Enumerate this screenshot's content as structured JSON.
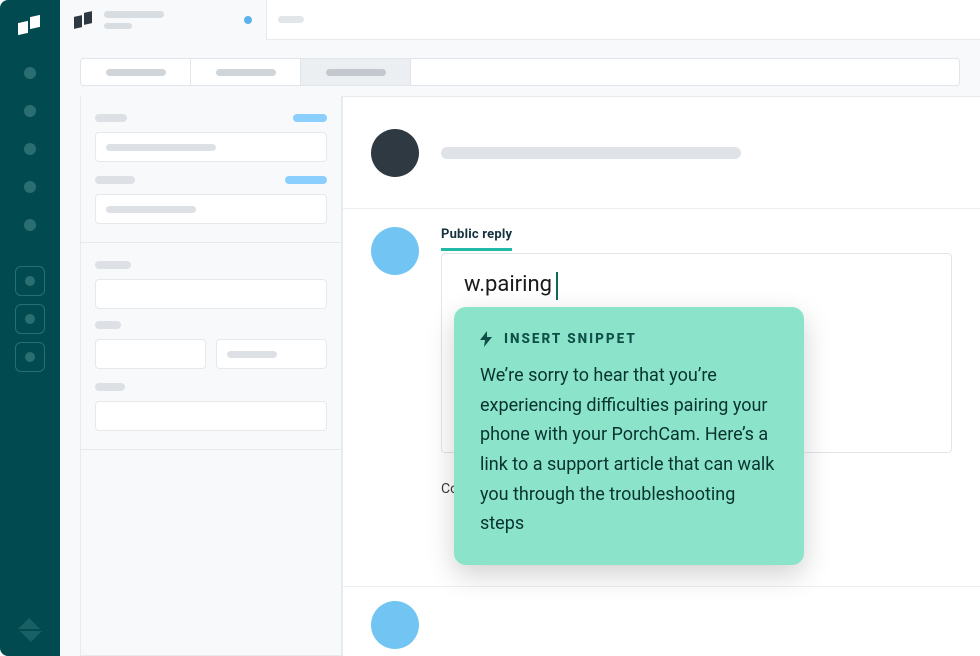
{
  "reply": {
    "tab_label": "Public reply",
    "typed_text": "w.pairing",
    "footer_visible_text": "Co"
  },
  "snippet": {
    "title": "INSERT SNIPPET",
    "body": "We’re sorry to hear that you’re experiencing difficulties pairing your phone with your PorchCam. Here’s a link to a support article that can walk you through the troubleshooting steps"
  },
  "colors": {
    "rail_bg": "#014b50",
    "accent_teal": "#24b9a6",
    "snippet_bg": "#8be4c9",
    "avatar_blue": "#72c4f3",
    "avatar_dark": "#2f3941"
  },
  "icons": {
    "app_logo": "app-logo",
    "zendesk_mark": "zendesk-mark",
    "snippet_bolt": "lightning-bolt-icon"
  }
}
